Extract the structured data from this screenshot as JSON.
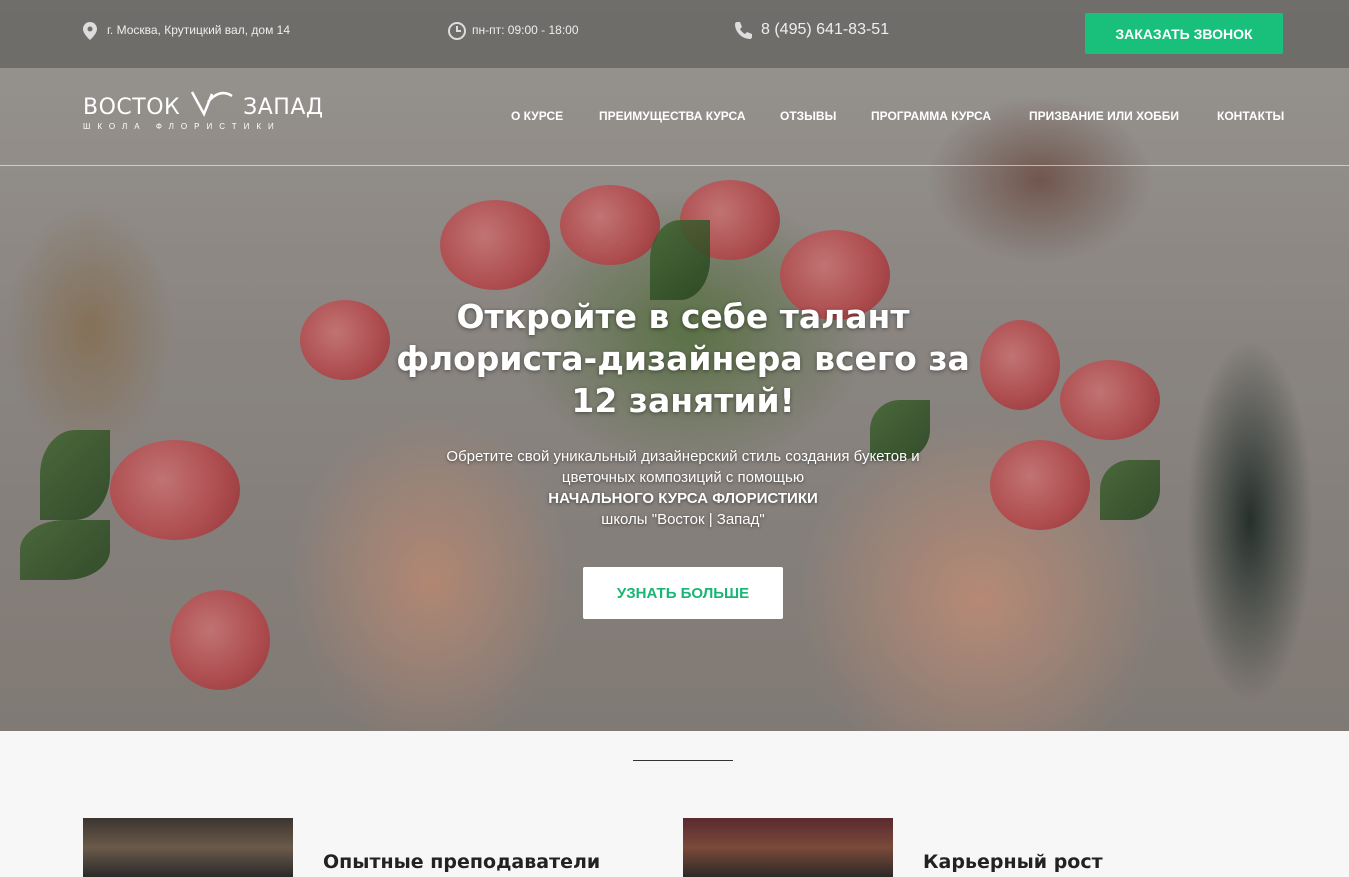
{
  "topbar": {
    "address": "г. Москва, Крутицкий вал, дом 14",
    "hours": "пн-пт: 09:00 - 18:00",
    "phone": "8 (495) 641-83-51",
    "call_button": "ЗАКАЗАТЬ ЗВОНОК",
    "icons": {
      "address": "map-pin-icon",
      "hours": "clock-icon",
      "phone": "phone-icon"
    }
  },
  "logo": {
    "left": "ВОСТОК",
    "right": "ЗАПАД",
    "subtitle": "ШКОЛА ФЛОРИСТИКИ"
  },
  "nav": {
    "items": [
      {
        "label": "О КУРСЕ"
      },
      {
        "label": "ПРЕИМУЩЕСТВА КУРСА"
      },
      {
        "label": "ОТЗЫВЫ"
      },
      {
        "label": "ПРОГРАММА КУРСА"
      },
      {
        "label": "ПРИЗВАНИЕ ИЛИ ХОББИ"
      },
      {
        "label": "КОНТАКТЫ"
      }
    ]
  },
  "hero": {
    "headline_1": "Откройте в себе талант",
    "headline_2": "флориста-дизайнера всего за",
    "headline_3": "12 занятий!",
    "sub_1": "Обретите свой уникальный дизайнерский стиль создания букетов и",
    "sub_2": "цветочных композиций с помощью",
    "sub_strong": "НАЧАЛЬНОГО КУРСА ФЛОРИСТИКИ",
    "sub_3": "школы \"Восток | Запад\"",
    "button": "УЗНАТЬ БОЛЬШЕ"
  },
  "features": [
    {
      "title": "Опытные преподаватели"
    },
    {
      "title": "Карьерный рост"
    }
  ],
  "colors": {
    "accent": "#19c07b",
    "white": "#ffffff"
  }
}
